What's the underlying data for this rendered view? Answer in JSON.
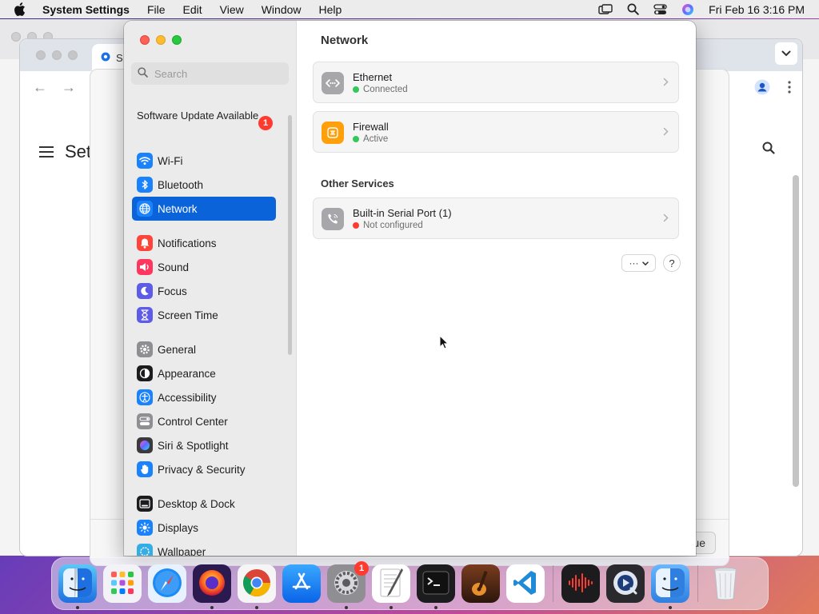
{
  "menubar": {
    "app_name": "System Settings",
    "menus": [
      "File",
      "Edit",
      "View",
      "Window",
      "Help"
    ],
    "clock": "Fri Feb 16  3:16 PM"
  },
  "background": {
    "tab_label": "S",
    "content_title": "Set",
    "continue_label": "ue"
  },
  "sidebar": {
    "search_placeholder": "Search",
    "update": {
      "label": "Software Update Available",
      "badge": "1"
    },
    "items": [
      {
        "label": "Wi-Fi",
        "icon": "wifi-icon",
        "color": "#1a82fb"
      },
      {
        "label": "Bluetooth",
        "icon": "bluetooth-icon",
        "color": "#1a82fb"
      },
      {
        "label": "Network",
        "icon": "globe-icon",
        "color": "#1a82fb",
        "active": true
      },
      {
        "label": "Notifications",
        "icon": "bell-icon",
        "color": "#ff453a"
      },
      {
        "label": "Sound",
        "icon": "speaker-icon",
        "color": "#ff375f"
      },
      {
        "label": "Focus",
        "icon": "moon-icon",
        "color": "#5e5ce6"
      },
      {
        "label": "Screen Time",
        "icon": "hourglass-icon",
        "color": "#5e5ce6"
      },
      {
        "label": "General",
        "icon": "gear-icon",
        "color": "#8e8e93"
      },
      {
        "label": "Appearance",
        "icon": "appearance-icon",
        "color": "#1c1c1e"
      },
      {
        "label": "Accessibility",
        "icon": "accessibility-icon",
        "color": "#1a82fb"
      },
      {
        "label": "Control Center",
        "icon": "control-center-icon",
        "color": "#8e8e93"
      },
      {
        "label": "Siri & Spotlight",
        "icon": "siri-icon",
        "color": "#3a3a3c"
      },
      {
        "label": "Privacy & Security",
        "icon": "hand-icon",
        "color": "#1a82fb"
      },
      {
        "label": "Desktop & Dock",
        "icon": "dock-icon",
        "color": "#1c1c1e"
      },
      {
        "label": "Displays",
        "icon": "sun-icon",
        "color": "#1a82fb"
      },
      {
        "label": "Wallpaper",
        "icon": "wallpaper-icon",
        "color": "#32ade6"
      }
    ]
  },
  "content": {
    "title": "Network",
    "services": [
      {
        "title": "Ethernet",
        "status": "Connected",
        "status_color": "#34c759",
        "icon": "ethernet-icon"
      },
      {
        "title": "Firewall",
        "status": "Active",
        "status_color": "#34c759",
        "icon": "firewall-icon"
      }
    ],
    "other_title": "Other Services",
    "other": [
      {
        "title": "Built-in Serial Port (1)",
        "status": "Not configured",
        "status_color": "#ff3b30",
        "icon": "phone-icon"
      }
    ],
    "more_label": "···",
    "help_label": "?"
  },
  "dock": {
    "apps": [
      {
        "name": "Finder",
        "icon": "finder-icon",
        "running": true
      },
      {
        "name": "Launchpad",
        "icon": "launchpad-icon"
      },
      {
        "name": "Safari",
        "icon": "safari-icon"
      },
      {
        "name": "Firefox",
        "icon": "firefox-icon",
        "running": true
      },
      {
        "name": "Chrome",
        "icon": "chrome-icon",
        "running": true
      },
      {
        "name": "App Store",
        "icon": "appstore-icon"
      },
      {
        "name": "System Settings",
        "icon": "settings-icon",
        "running": true,
        "badge": "1"
      },
      {
        "name": "TextEdit",
        "icon": "textedit-icon",
        "running": true
      },
      {
        "name": "Terminal",
        "icon": "terminal-icon",
        "running": true
      },
      {
        "name": "GarageBand",
        "icon": "garageband-icon"
      },
      {
        "name": "VS Code",
        "icon": "vscode-icon"
      },
      {
        "name": "Voice Memos",
        "icon": "voice-memos-icon"
      },
      {
        "name": "QuickTime",
        "icon": "quicktime-icon"
      },
      {
        "name": "Finder",
        "icon": "finder2-icon",
        "running": true
      },
      {
        "name": "Trash",
        "icon": "trash-icon"
      }
    ]
  }
}
